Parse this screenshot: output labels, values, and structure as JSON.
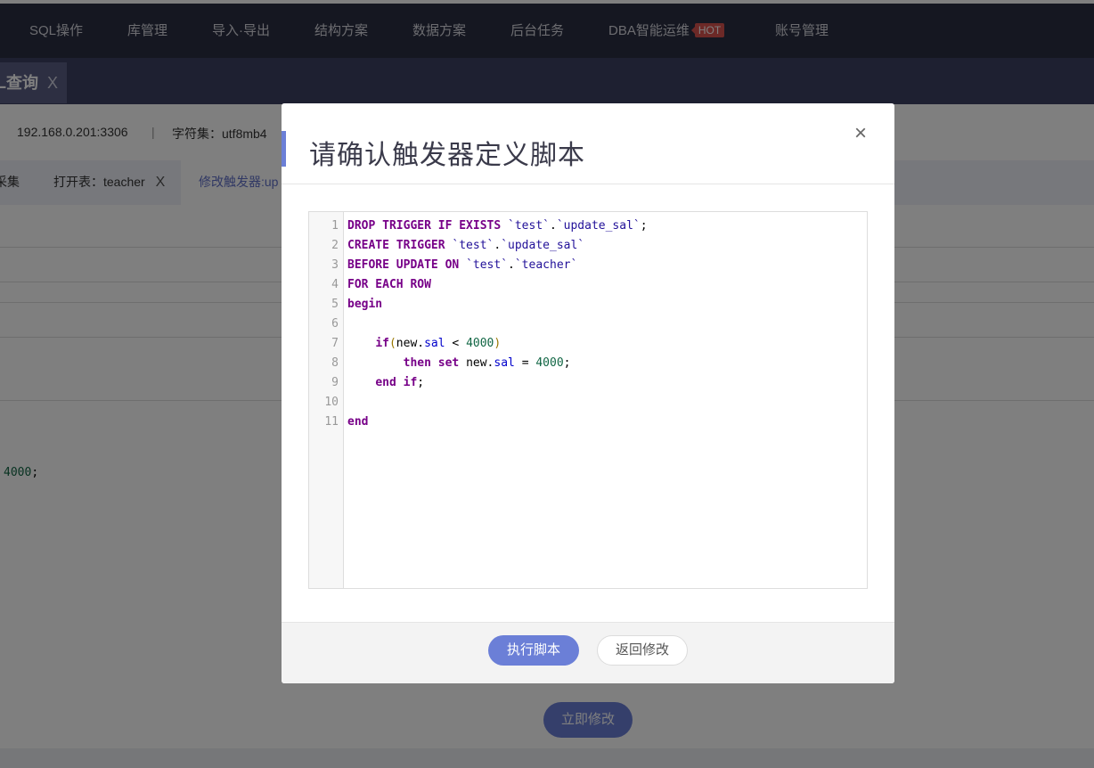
{
  "nav": {
    "items": [
      {
        "label": "SQL操作"
      },
      {
        "label": "库管理"
      },
      {
        "label": "导入·导出"
      },
      {
        "label": "结构方案"
      },
      {
        "label": "数据方案"
      },
      {
        "label": "后台任务"
      },
      {
        "label": "DBA智能运维",
        "badge": "HOT"
      },
      {
        "label": "账号管理"
      }
    ]
  },
  "tabs": {
    "active_label": "L查询",
    "active_close": "X"
  },
  "info": {
    "host": "192.168.0.201:3306",
    "separator": "|",
    "charset": "字符集：utf8mb4"
  },
  "subtabs": [
    {
      "label": "采集"
    },
    {
      "label": "打开表：teacher",
      "close": "X"
    },
    {
      "label": "修改触发器:up"
    }
  ],
  "background": {
    "code_fragment_num": "4000",
    "code_fragment_punct": ";",
    "submit_label": "立即修改"
  },
  "modal": {
    "title": "请确认触发器定义脚本",
    "close_icon": "×",
    "line_numbers": [
      "1",
      "2",
      "3",
      "4",
      "5",
      "6",
      "7",
      "8",
      "9",
      "10",
      "11"
    ],
    "code": {
      "l1_kw": "DROP TRIGGER IF EXISTS",
      "l1_str1": "`test`",
      "l1_dot": ".",
      "l1_str2": "`update_sal`",
      "l1_end": ";",
      "l2_kw": "CREATE TRIGGER",
      "l2_str1": "`test`",
      "l2_dot": ".",
      "l2_str2": "`update_sal`",
      "l3_kw": "BEFORE UPDATE ON",
      "l3_str1": "`test`",
      "l3_dot": ".",
      "l3_str2": "`teacher`",
      "l4_kw": "FOR EACH ROW",
      "l5_kw": "begin",
      "l7_kw": "if",
      "l7_open": "(",
      "l7_obj": "new.",
      "l7_prop": "sal",
      "l7_op": " < ",
      "l7_num": "4000",
      "l7_close": ")",
      "l8_kw": "then set",
      "l8_obj": " new.",
      "l8_prop": "sal",
      "l8_op": " = ",
      "l8_num": "4000",
      "l8_end": ";",
      "l9_kw": "end if",
      "l9_end": ";",
      "l11_kw": "end"
    },
    "exec_label": "执行脚本",
    "back_label": "返回修改"
  },
  "colors": {
    "accent": "#6b7fd7",
    "topbar": "#2b2e42",
    "hot_badge": "#d9534f"
  }
}
